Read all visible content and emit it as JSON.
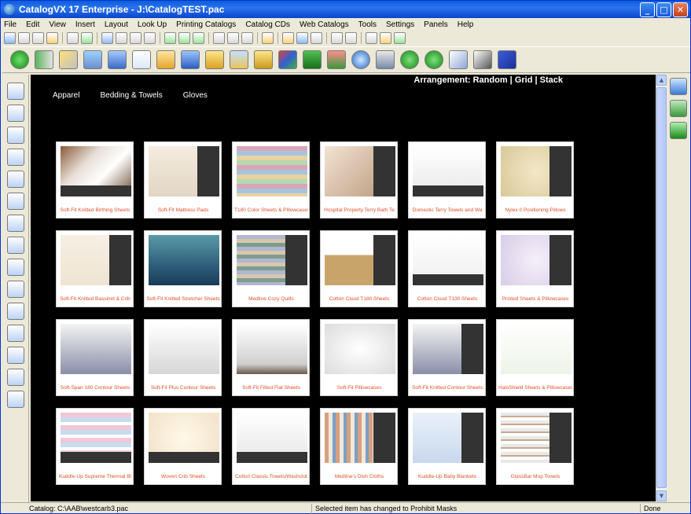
{
  "window": {
    "title": "CatalogVX 17 Enterprise - J:\\CatalogTEST.pac"
  },
  "menu": [
    "File",
    "Edit",
    "View",
    "Insert",
    "Layout",
    "Look Up",
    "Printing Catalogs",
    "Catalog CDs",
    "Web Catalogs",
    "Tools",
    "Settings",
    "Panels",
    "Help"
  ],
  "arrangement": {
    "label": "Arrangement:",
    "random": "Random",
    "grid": "Grid",
    "stack": "Stack",
    "sep": "|"
  },
  "categories": [
    "Apparel",
    "Bedding & Towels",
    "Gloves"
  ],
  "products": [
    {
      "name": "Soft-Fit Knitted Birthing Sheets",
      "thumb": "bed-photo"
    },
    {
      "name": "Soft-Fit Mattress Pads",
      "thumb": "pad-photo"
    },
    {
      "name": "T180 Color Sheets & Pillowcases",
      "thumb": "color-sheets-photo"
    },
    {
      "name": "Hospital Property Terry Bath Te",
      "thumb": "terry-photo"
    },
    {
      "name": "Domestic Terry Towels and Wa",
      "thumb": "towels-photo"
    },
    {
      "name": "Nylex II Positioning Pillows",
      "thumb": "pillows-photo"
    },
    {
      "name": "Soft-Fit Knitted Bassinet & Crib",
      "thumb": "bassinet-photo"
    },
    {
      "name": "Soft-Fit Knitted Stretcher Sheets",
      "thumb": "stretcher-photo"
    },
    {
      "name": "Medline Cozy Quilts",
      "thumb": "quilts-photo"
    },
    {
      "name": "Cotton Cloud T180 Sheets",
      "thumb": "basket-photo"
    },
    {
      "name": "Cotton Cloud T130 Sheets",
      "thumb": "t130-photo"
    },
    {
      "name": "Printed Sheets & Pillowcases",
      "thumb": "printed-photo"
    },
    {
      "name": "Soft-Span 180 Contour Sheets",
      "thumb": "contour-photo"
    },
    {
      "name": "Soft-Fit Plus Contour Sheets",
      "thumb": "plus-contour-photo"
    },
    {
      "name": "Soft-Fit Fitted Flat Sheets",
      "thumb": "flat-sheets-photo"
    },
    {
      "name": "Soft-Fit Pillowcases",
      "thumb": "pillowcase-photo"
    },
    {
      "name": "Soft-Fit Knitted Contour Sheets",
      "thumb": "knit-contour-photo"
    },
    {
      "name": "HaloShield Sheets & Pillowcases",
      "thumb": "diagram-photo"
    },
    {
      "name": "Kuddle-Up Supreme Thermal Bl",
      "thumb": "thermal-photo"
    },
    {
      "name": "Woven Crib Sheets",
      "thumb": "crib-photo"
    },
    {
      "name": "Cotton Classic Towels/Washclot",
      "thumb": "classic-towels-photo"
    },
    {
      "name": "Medline's Dish Cloths",
      "thumb": "dish-photo"
    },
    {
      "name": "Kuddle-Up Baby Blankets",
      "thumb": "baby-blanket-photo"
    },
    {
      "name": "GlassBar Mop Towels",
      "thumb": "mop-photo"
    }
  ],
  "status": {
    "catalog": "Catalog: C:\\AAB\\westcarb3.pac",
    "message": "Selected item has changed to Prohibit Masks",
    "state": "Done"
  }
}
